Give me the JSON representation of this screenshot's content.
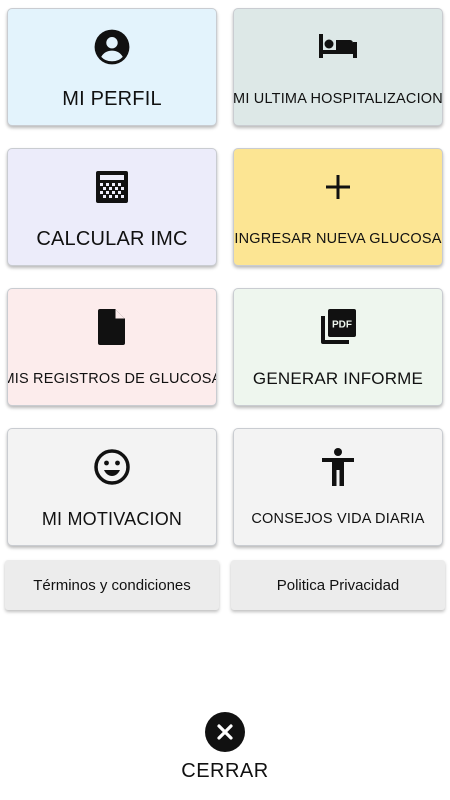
{
  "tiles": [
    {
      "label": "MI PERFIL",
      "icon": "account-circle-icon",
      "color": "#e3f3fc"
    },
    {
      "label": "MI ULTIMA HOSPITALIZACION",
      "icon": "hotel-bed-icon",
      "color": "#dde8e7"
    },
    {
      "label": "CALCULAR IMC",
      "icon": "calculator-grid-icon",
      "color": "#ececfa"
    },
    {
      "label": "INGRESAR NUEVA GLUCOSA",
      "icon": "plus-icon",
      "color": "#fce593"
    },
    {
      "label": "MIS REGISTROS DE GLUCOSA",
      "icon": "document-icon",
      "color": "#fcecec"
    },
    {
      "label": "GENERAR INFORME",
      "icon": "pdf-icon",
      "color": "#eef6ee"
    },
    {
      "label": "MI MOTIVACION",
      "icon": "smiley-face-icon",
      "color": "#f3f3f3"
    },
    {
      "label": "CONSEJOS VIDA DIARIA",
      "icon": "accessibility-person-icon",
      "color": "#f3f3f3"
    }
  ],
  "links": {
    "terms": "Términos y condiciones",
    "privacy": "Politica Privacidad"
  },
  "close": {
    "label": "CERRAR",
    "icon": "close-circle-icon"
  }
}
